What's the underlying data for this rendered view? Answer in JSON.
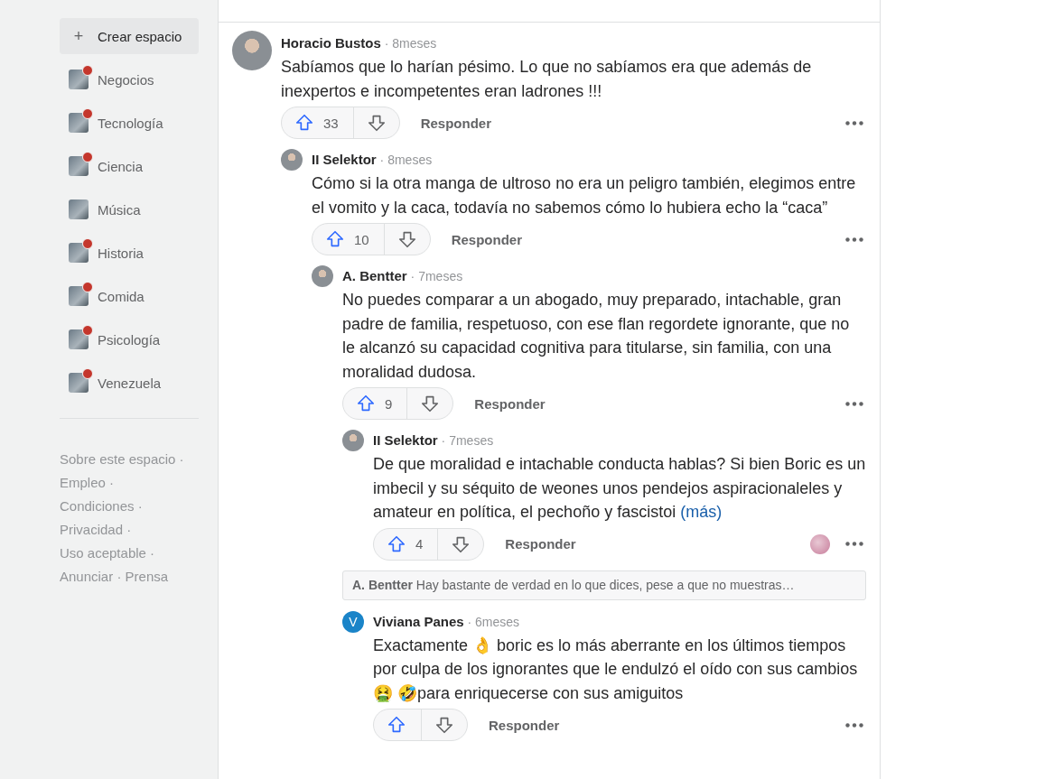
{
  "sidebar": {
    "create_button": {
      "icon": "+",
      "label": "Crear espacio"
    },
    "spaces": [
      {
        "name": "Negocios",
        "unread": true
      },
      {
        "name": "Tecnología",
        "unread": true
      },
      {
        "name": "Ciencia",
        "unread": true
      },
      {
        "name": "Música",
        "unread": false
      },
      {
        "name": "Historia",
        "unread": true
      },
      {
        "name": "Comida",
        "unread": true
      },
      {
        "name": "Psicología",
        "unread": true
      },
      {
        "name": "Venezuela",
        "unread": true
      }
    ],
    "footer_separator": "·",
    "footer_links": [
      "Sobre este espacio",
      "Empleo",
      "Condiciones",
      "Privacidad",
      "Uso aceptable",
      "Anunciar",
      "Prensa"
    ]
  },
  "meta_separator": "·",
  "comments": [
    {
      "kind": "comment",
      "author": "Horacio Bustos",
      "time": "8meses",
      "avatar": {
        "kind": "photo"
      },
      "body": "Sabíamos que lo harían pésimo. Lo que no sabíamos era que además de inexpertos e incompetentes eran ladrones !!!",
      "upvotes": "33",
      "reply_label": "Responder",
      "children": [
        {
          "kind": "comment",
          "author": "II Selektor",
          "time": "8meses",
          "avatar": {
            "kind": "photo"
          },
          "body": "Cómo si la otra manga de ultroso no era un peligro también, elegimos entre el vomito y la caca, todavía no sabemos cómo lo hubiera echo la “caca”",
          "upvotes": "10",
          "reply_label": "Responder",
          "children": [
            {
              "kind": "comment",
              "author": "A. Bentter",
              "time": "7meses",
              "avatar": {
                "kind": "photo"
              },
              "body": "No puedes comparar a un abogado, muy preparado, intachable, gran padre de familia, respetuoso, con ese flan regordete ignorante, que no le alcanzó su capacidad cognitiva para titularse, sin familia, con una moralidad dudosa.",
              "upvotes": "9",
              "reply_label": "Responder",
              "children": [
                {
                  "kind": "comment",
                  "author": "II Selektor",
                  "time": "7meses",
                  "avatar": {
                    "kind": "photo"
                  },
                  "body": "De que moralidad e intachable conducta hablas? Si bien Boric es un imbecil y su séquito de weones unos pendejos aspiracionaleles y amateur en política, el pechoño y fascistoi",
                  "more_link": "(más)",
                  "upvotes": "4",
                  "reply_label": "Responder",
                  "replier_avatar": true
                },
                {
                  "kind": "collapsed",
                  "author": "A. Bentter",
                  "snippet": "Hay bastante de verdad en lo que dices, pese a que no muestras…"
                },
                {
                  "kind": "comment",
                  "author": "Viviana Panes",
                  "time": "6meses",
                  "avatar": {
                    "kind": "letter",
                    "letter": "V"
                  },
                  "body": "Exactamente 👌 boric es lo más aberrante en los últimos tiempos por culpa de los ignorantes que le endulzó el oído con sus cambios 🤮 🤣para enriquecerse con sus amiguitos",
                  "reply_label": "Responder"
                }
              ]
            }
          ]
        }
      ]
    }
  ]
}
